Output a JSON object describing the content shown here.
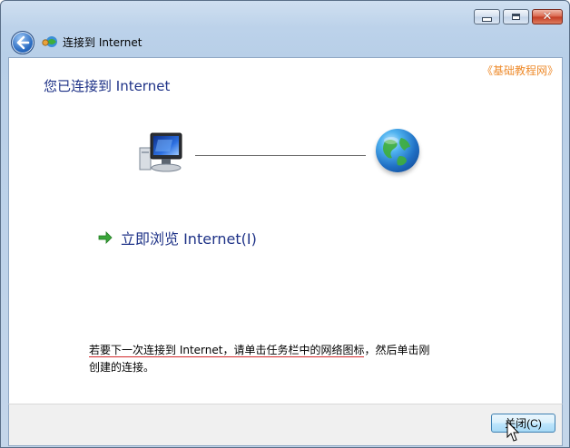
{
  "window": {
    "title": "连接到 Internet",
    "controls": {
      "close_glyph": "✕"
    }
  },
  "content": {
    "watermark": "《基础教程网》",
    "heading": "您已连接到 Internet",
    "browse_label": "立即浏览 Internet(I)",
    "note": {
      "part1": "若要下一次连接到 Internet，请单击任务栏中的网络图标",
      "part2": "，然后单击刚创建的连接。"
    }
  },
  "footer": {
    "close_button": "关闭(C)"
  },
  "colors": {
    "heading": "#1e3287",
    "watermark": "#ee8b2c",
    "underline": "#d3282a",
    "arrow": "#3aa53a"
  },
  "icons": [
    "back-arrow-icon",
    "network-connection-icon",
    "computer-icon",
    "globe-icon",
    "green-arrow-icon",
    "mouse-cursor-icon"
  ]
}
